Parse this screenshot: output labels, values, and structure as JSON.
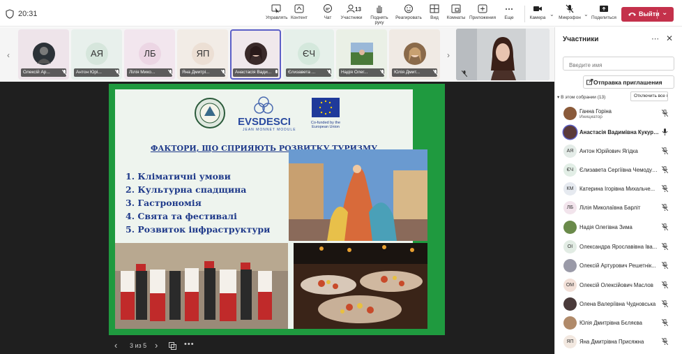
{
  "topbar": {
    "clock": "20:31",
    "buttons": [
      {
        "label": "Управлять",
        "icon": "share-control-icon"
      },
      {
        "label": "Контент",
        "icon": "content-icon"
      },
      {
        "label": "Чат",
        "icon": "chat-icon"
      },
      {
        "label": "Участники",
        "icon": "participants-icon",
        "count": "13"
      },
      {
        "label": "Поднять руку",
        "icon": "raise-hand-icon"
      },
      {
        "label": "Реагировать",
        "icon": "smile-icon"
      },
      {
        "label": "Вид",
        "icon": "grid-view-icon"
      },
      {
        "label": "Комнаты",
        "icon": "breakout-rooms-icon"
      },
      {
        "label": "Приложения",
        "icon": "add-apps-icon"
      },
      {
        "label": "Еще",
        "icon": "more-icon"
      },
      {
        "label": "Камера",
        "icon": "camera-icon"
      },
      {
        "label": "Микрофон",
        "icon": "mic-off-icon"
      },
      {
        "label": "Поделиться",
        "icon": "share-screen-icon"
      }
    ],
    "leave_label": "Выйти",
    "leave_color": "#c4314b"
  },
  "strip": {
    "tiles": [
      {
        "name": "Олексій Ар...",
        "initials": "",
        "type": "photo",
        "bg": "#eee4ea"
      },
      {
        "name": "Антон Юрі...",
        "initials": "АЯ",
        "type": "initials",
        "bg": "#e8f0ec"
      },
      {
        "name": "Лілія Мико...",
        "initials": "ЛБ",
        "type": "initials",
        "bg": "#f2e6ee"
      },
      {
        "name": "Яна Дмитрі...",
        "initials": "ЯП",
        "type": "initials",
        "bg": "#f2ece6"
      },
      {
        "name": "Анастасія Вади...",
        "initials": "",
        "type": "photo",
        "bg": "#f0e8ec"
      },
      {
        "name": "Єлизавета ...",
        "initials": "ЄЧ",
        "type": "initials",
        "bg": "#e6f0ea"
      },
      {
        "name": "Надія Олег...",
        "initials": "",
        "type": "photo",
        "bg": "#eaf0e6"
      },
      {
        "name": "Юлія Дмит...",
        "initials": "",
        "type": "photo",
        "bg": "#f0eae4"
      }
    ]
  },
  "slide": {
    "logo_text": "EVSDESCI",
    "logo_sub": "JEAN MONNET MODULE",
    "eu_text": "Co-funded by the European Union",
    "title": "ФАКТОРИ, ЩО СПРИЯЮТЬ РОЗВИТКУ ТУРИЗМУ",
    "factors": [
      "1. Кліматичні умови",
      "2. Культурна спадщина",
      "3. Гастрономія",
      "4. Свята та фестивалі",
      "5. Розвиток інфраструктури"
    ],
    "page_indicator": "3 из 5"
  },
  "panel": {
    "title": "Участники",
    "search_placeholder": "Введите имя",
    "invite_label": "Отправка приглашения",
    "section_label": "В этом собрании (13)",
    "mute_all_label": "Отключить все мик...",
    "participants": [
      {
        "name": "Ганна Горіна",
        "role": "Инициатор",
        "initials": "",
        "avatar_bg": "#8a5a3a",
        "mic": "off"
      },
      {
        "name": "Анастасія Вадимівна Кукуруза",
        "role": "",
        "initials": "",
        "avatar_bg": "#5a3a3a",
        "mic": "on",
        "bold": true
      },
      {
        "name": "Антон Юрійович Ягідка",
        "role": "",
        "initials": "АЯ",
        "avatar_bg": "#e4ece8",
        "mic": "off"
      },
      {
        "name": "Єлизавета Сергіївна Чемодур...",
        "role": "",
        "initials": "ЄЧ",
        "avatar_bg": "#e2eee6",
        "mic": "off"
      },
      {
        "name": "Катерина Ігорівна Михальче...",
        "role": "",
        "initials": "КМ",
        "avatar_bg": "#e6eaf0",
        "mic": "off"
      },
      {
        "name": "Лілія Миколаївна Барліт",
        "role": "",
        "initials": "ЛБ",
        "avatar_bg": "#f2e4ec",
        "mic": "off"
      },
      {
        "name": "Надія Олегівна Зима",
        "role": "",
        "initials": "",
        "avatar_bg": "#6a8a4a",
        "mic": "off"
      },
      {
        "name": "Олександра Ярославівна Іва...",
        "role": "",
        "initials": "ОІ",
        "avatar_bg": "#e2ece4",
        "mic": "off"
      },
      {
        "name": "Олексій Артурович Решетнік...",
        "role": "",
        "initials": "",
        "avatar_bg": "#9a9aa8",
        "mic": "off"
      },
      {
        "name": "Олексій Олексійович Маслов",
        "role": "",
        "initials": "ОМ",
        "avatar_bg": "#f2e0d8",
        "mic": "off"
      },
      {
        "name": "Олена Валеріївна Чудновська",
        "role": "",
        "initials": "",
        "avatar_bg": "#4a3a3a",
        "mic": "off"
      },
      {
        "name": "Юлія Дмитрівна Бєляєва",
        "role": "",
        "initials": "",
        "avatar_bg": "#b08a6a",
        "mic": "off"
      },
      {
        "name": "Яна Дмитрівна Присяжна",
        "role": "",
        "initials": "ЯП",
        "avatar_bg": "#f2e8e0",
        "mic": "off"
      }
    ]
  }
}
